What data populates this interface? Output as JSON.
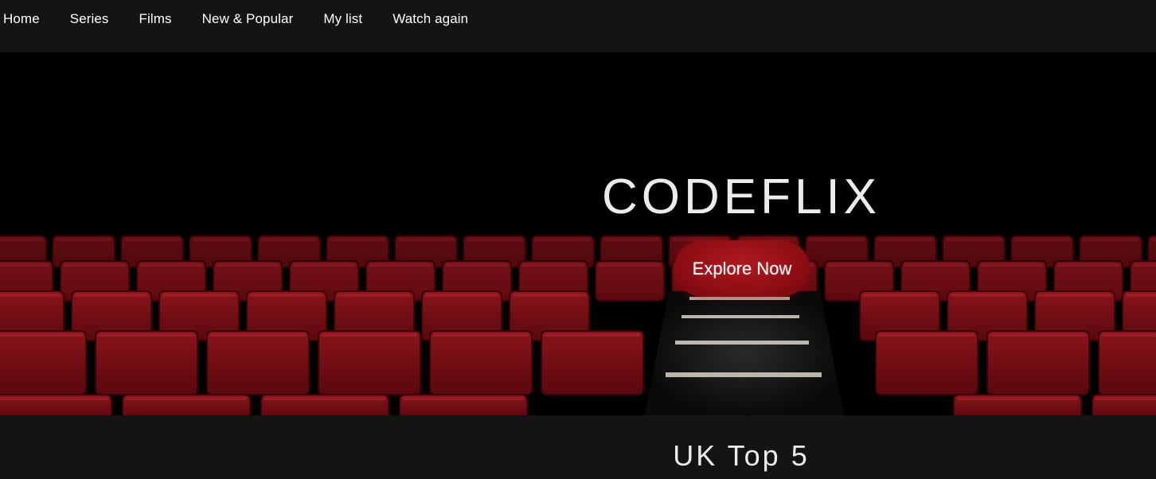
{
  "nav": {
    "items": [
      {
        "label": "Home"
      },
      {
        "label": "Series"
      },
      {
        "label": "Films"
      },
      {
        "label": "New & Popular"
      },
      {
        "label": "My list"
      },
      {
        "label": "Watch again"
      }
    ]
  },
  "hero": {
    "title": "CODEFLIX",
    "cta_label": "Explore Now",
    "image": "cinema-seats-image"
  },
  "section": {
    "title": "UK Top 5"
  },
  "colors": {
    "background": "#141414",
    "accent": "#9a0f16",
    "seat_red": "#7a1016",
    "text": "#ececec"
  }
}
